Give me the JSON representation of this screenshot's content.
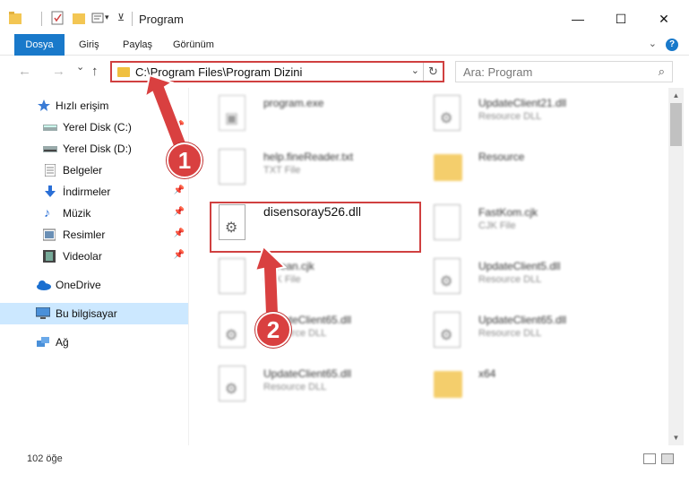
{
  "window": {
    "title": "Program",
    "minimize": "—",
    "maximize": "☐",
    "close": "✕"
  },
  "ribbon": {
    "tabs": [
      "Dosya",
      "Giriş",
      "Paylaş",
      "Görünüm"
    ],
    "help": "?"
  },
  "nav": {
    "back": "←",
    "forward": "→",
    "recent": "⌄",
    "up": "↑",
    "address": "C:\\Program Files\\Program Dizini",
    "address_dropdown": "⌄",
    "refresh": "↻",
    "search_placeholder": "Ara: Program",
    "search_icon": "⌕"
  },
  "sidebar": {
    "items": [
      {
        "label": "Hızlı erişim",
        "icon": "star-icon",
        "pinned": false
      },
      {
        "label": "Yerel Disk (C:)",
        "icon": "drive-icon",
        "pinned": true
      },
      {
        "label": "Yerel Disk (D:)",
        "icon": "drive-icon",
        "pinned": false
      },
      {
        "label": "Belgeler",
        "icon": "documents-icon",
        "pinned": true
      },
      {
        "label": "İndirmeler",
        "icon": "download-icon",
        "pinned": true
      },
      {
        "label": "Müzik",
        "icon": "music-icon",
        "pinned": true
      },
      {
        "label": "Resimler",
        "icon": "pictures-icon",
        "pinned": true
      },
      {
        "label": "Videolar",
        "icon": "video-icon",
        "pinned": true
      },
      {
        "label": "OneDrive",
        "icon": "cloud-icon",
        "pinned": false
      },
      {
        "label": "Bu bilgisayar",
        "icon": "computer-icon",
        "pinned": false,
        "selected": true
      },
      {
        "label": "Ağ",
        "icon": "network-icon",
        "pinned": false
      }
    ],
    "pin_glyph": "📌"
  },
  "files": [
    {
      "name": "program.exe",
      "desc": "",
      "kind": "exe"
    },
    {
      "name": "UpdateClient21.dll",
      "desc": "Resource DLL",
      "kind": "dll"
    },
    {
      "name": "help.fineReader.txt",
      "desc": "TXT File",
      "kind": "txt"
    },
    {
      "name": "Resource",
      "desc": "",
      "kind": "folder"
    },
    {
      "name": "disensoray526.dll",
      "desc": "",
      "kind": "dll",
      "highlighted": true
    },
    {
      "name": "FastKom.cjk",
      "desc": "CJK File",
      "kind": "txt"
    },
    {
      "name": "Korean.cjk",
      "desc": "CJK File",
      "kind": "txt"
    },
    {
      "name": "UpdateClient5.dll",
      "desc": "Resource DLL",
      "kind": "dll"
    },
    {
      "name": "UpdateClient65.dll",
      "desc": "Resource DLL",
      "kind": "dll"
    },
    {
      "name": "UpdateClient65.dll",
      "desc": "Resource DLL",
      "kind": "dll"
    },
    {
      "name": "UpdateClient65.dll",
      "desc": "Resource DLL",
      "kind": "dll"
    },
    {
      "name": "x64",
      "desc": "",
      "kind": "folder"
    }
  ],
  "status": {
    "count": "102 öğe"
  },
  "annotations": {
    "step1": "1",
    "step2": "2",
    "color": "#d94040"
  }
}
